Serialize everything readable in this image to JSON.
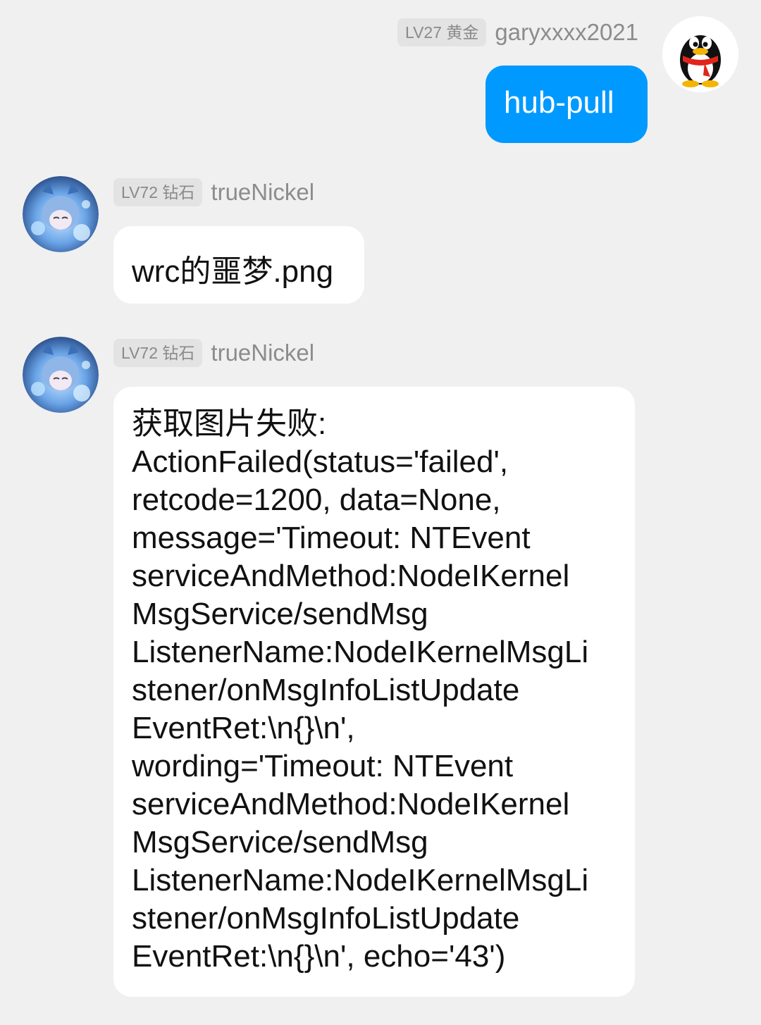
{
  "messages": [
    {
      "sender": "garyxxxx2021",
      "level": "LV27 黄金",
      "text": "hub-pull",
      "avatar": "qq-penguin-icon"
    },
    {
      "sender": "trueNickel",
      "level": "LV72 钻石",
      "text": "wrc的噩梦.png",
      "avatar": "anime-girl-avatar"
    },
    {
      "sender": "trueNickel",
      "level": "LV72 钻石",
      "text": "获取图片失败:\nActionFailed(status='failed',\nretcode=1200, data=None,\nmessage='Timeout: NTEvent\nserviceAndMethod:NodeIKernel\nMsgService/sendMsg\nListenerName:NodeIKernelMsgLi\nstener/onMsgInfoListUpdate\nEventRet:\\n{}\\n',\nwording='Timeout: NTEvent\nserviceAndMethod:NodeIKernel\nMsgService/sendMsg\nListenerName:NodeIKernelMsgLi\nstener/onMsgInfoListUpdate\nEventRet:\\n{}\\n', echo='43')",
      "avatar": "anime-girl-avatar"
    }
  ],
  "colors": {
    "self_bubble": "#0099ff",
    "other_bubble": "#ffffff",
    "background": "#f0f0f0"
  }
}
